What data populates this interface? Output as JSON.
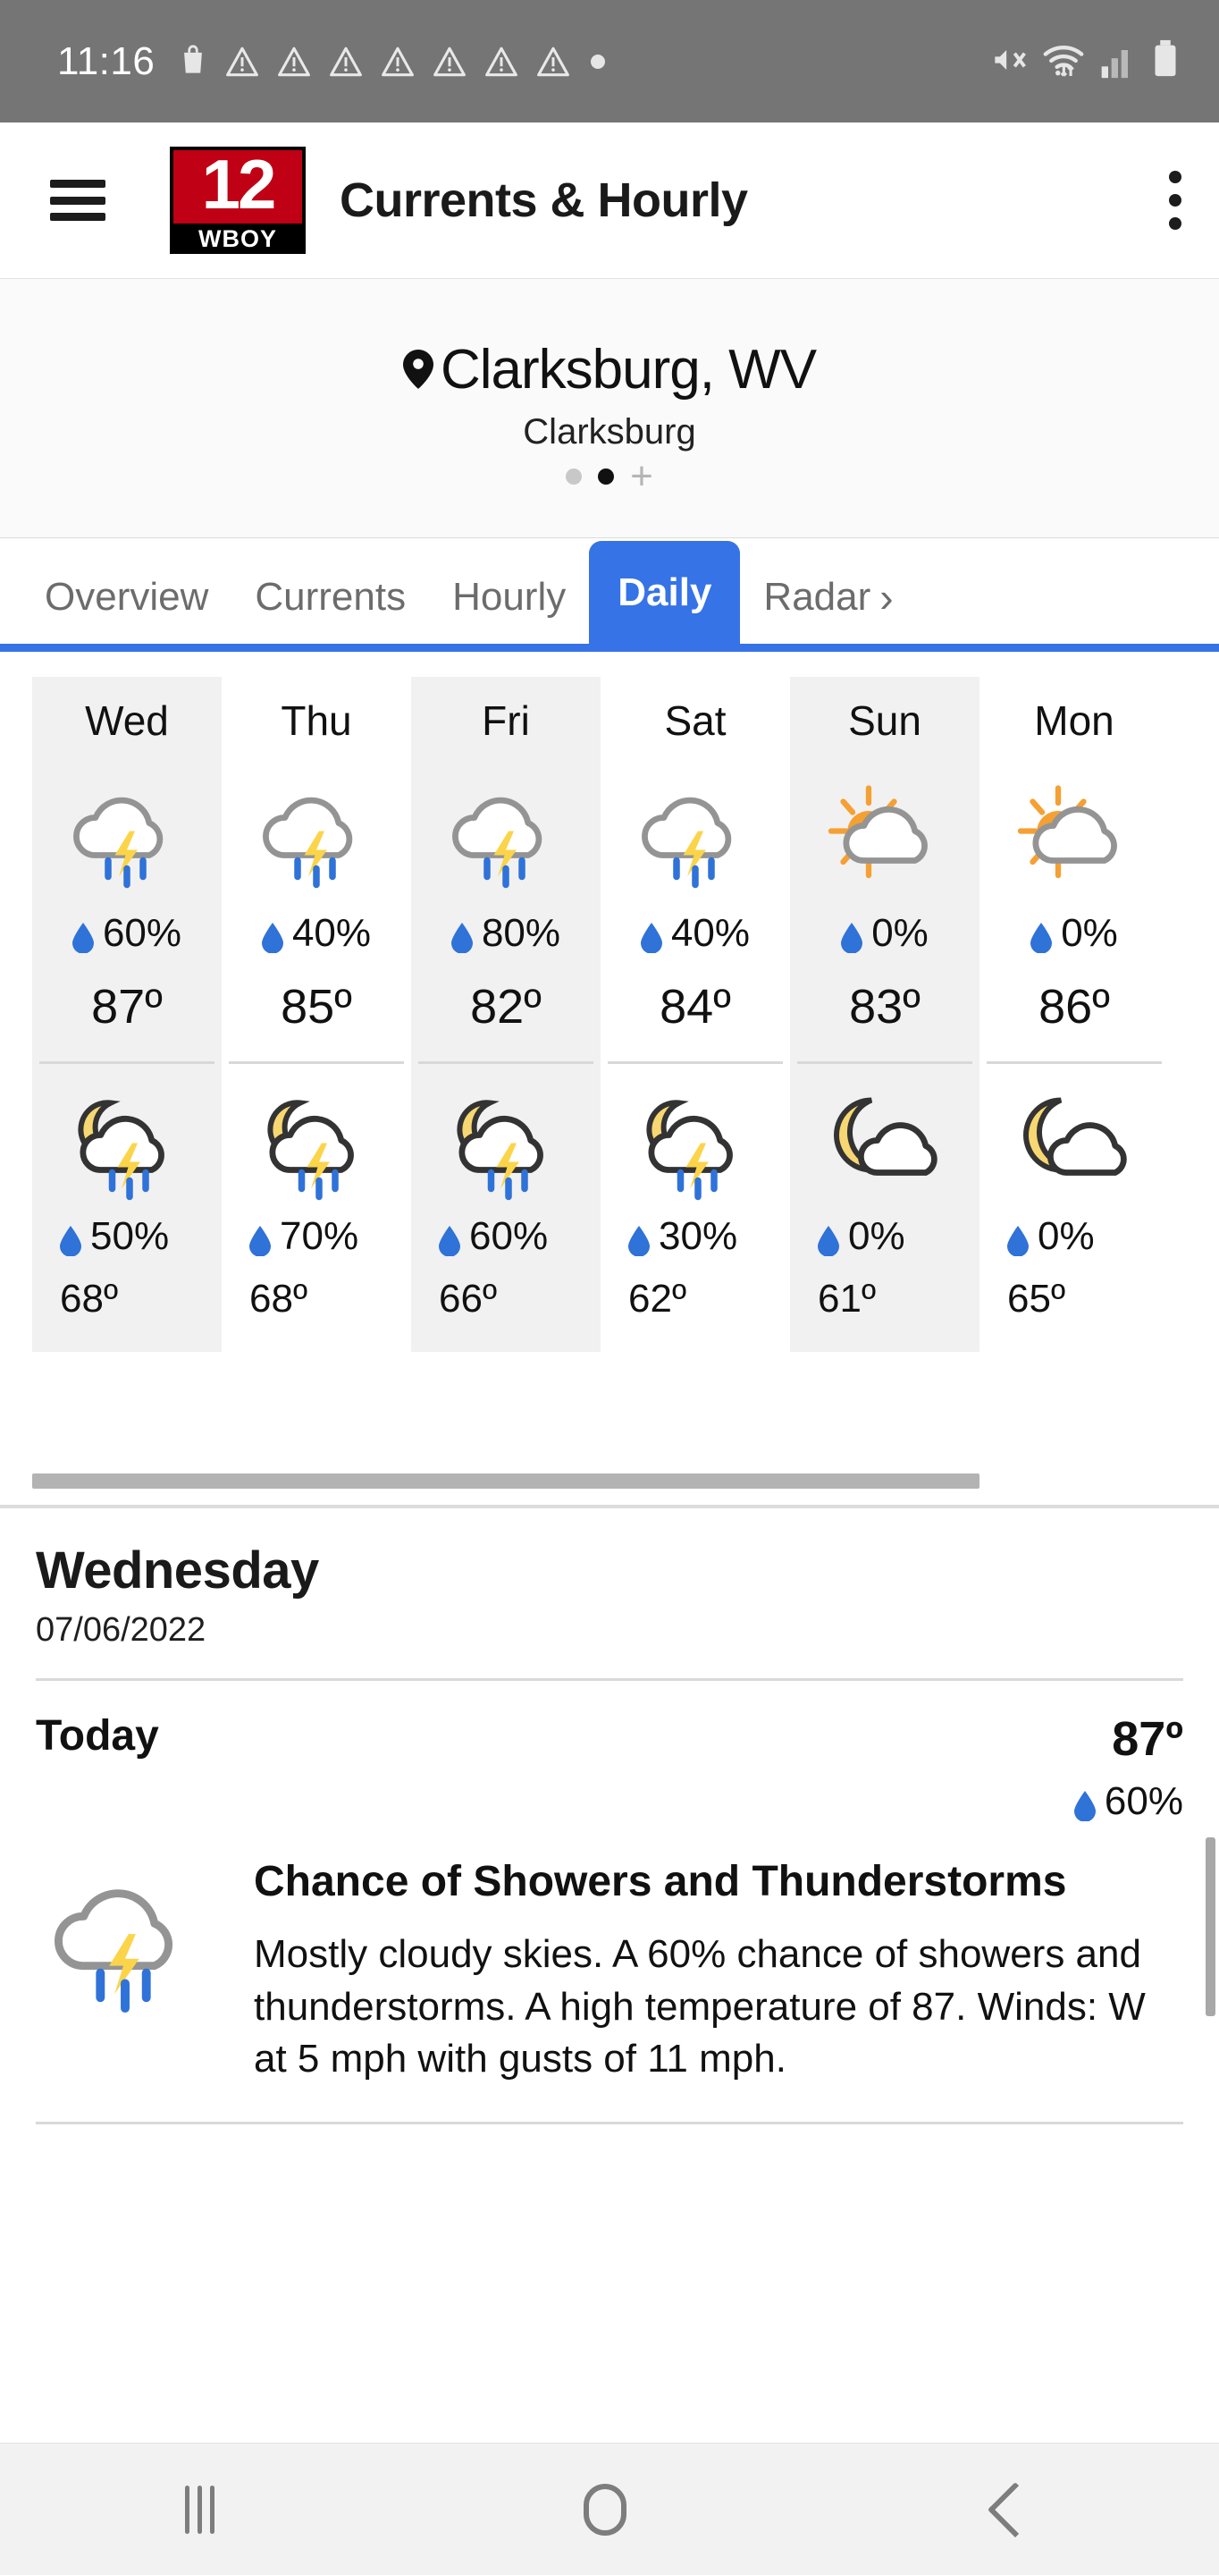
{
  "statusbar": {
    "clock": "11:16",
    "left_icons": [
      "shopping-bag-icon",
      "warning-triangle-icon",
      "warning-triangle-icon",
      "warning-triangle-icon",
      "warning-triangle-icon",
      "warning-triangle-icon",
      "warning-triangle-icon",
      "warning-triangle-icon",
      "more-dot-icon"
    ],
    "right_icons": [
      "mute-icon",
      "wifi-icon",
      "cellular-signal-icon",
      "battery-icon"
    ]
  },
  "appbar": {
    "menu_icon": "hamburger-icon",
    "logo_number": "12",
    "logo_callsign": "WBOY",
    "title": "Currents & Hourly",
    "overflow_icon": "kebab-menu-icon"
  },
  "location": {
    "pin_icon": "location-pin-icon",
    "name": "Clarksburg, WV",
    "sub": "Clarksburg",
    "pager": {
      "count": 2,
      "active_index": 1,
      "add_label": "+"
    }
  },
  "tabs": {
    "items": [
      {
        "label": "Overview",
        "active": false
      },
      {
        "label": "Currents",
        "active": false
      },
      {
        "label": "Hourly",
        "active": false
      },
      {
        "label": "Daily",
        "active": true
      },
      {
        "label": "Radar",
        "active": false
      }
    ],
    "overflow_icon": "chevron-right-icon",
    "accent_color": "#3573e6"
  },
  "daily": [
    {
      "day": "Wed",
      "day_icon": "thunderstorm-day-icon",
      "day_pop": "60%",
      "high": "87º",
      "night_icon": "thunderstorm-night-icon",
      "night_pop": "50%",
      "low": "68º"
    },
    {
      "day": "Thu",
      "day_icon": "thunderstorm-day-icon",
      "day_pop": "40%",
      "high": "85º",
      "night_icon": "thunderstorm-night-icon",
      "night_pop": "70%",
      "low": "68º"
    },
    {
      "day": "Fri",
      "day_icon": "thunderstorm-day-icon",
      "day_pop": "80%",
      "high": "82º",
      "night_icon": "thunderstorm-night-icon",
      "night_pop": "60%",
      "low": "66º"
    },
    {
      "day": "Sat",
      "day_icon": "thunderstorm-day-icon",
      "day_pop": "40%",
      "high": "84º",
      "night_icon": "thunderstorm-night-icon",
      "night_pop": "30%",
      "low": "62º"
    },
    {
      "day": "Sun",
      "day_icon": "partly-sunny-icon",
      "day_pop": "0%",
      "high": "83º",
      "night_icon": "partly-cloudy-night-icon",
      "night_pop": "0%",
      "low": "61º"
    },
    {
      "day": "Mon",
      "day_icon": "partly-sunny-icon",
      "day_pop": "0%",
      "high": "86º",
      "night_icon": "partly-cloudy-night-icon",
      "night_pop": "0%",
      "low": "65º"
    }
  ],
  "detail": {
    "weekday": "Wednesday",
    "date": "07/06/2022",
    "period_label": "Today",
    "period_temp": "87º",
    "period_pop": "60%",
    "condition_icon": "thunderstorm-day-icon",
    "condition_title": "Chance of Showers and Thunderstorms",
    "description": "Mostly cloudy skies.  A 60% chance of showers and thunderstorms.  A high temperature of 87.  Winds: W at 5 mph with gusts of 11 mph."
  },
  "navbar": {
    "recents_icon": "recents-icon",
    "home_icon": "home-icon",
    "back_icon": "back-icon"
  },
  "colors": {
    "accent": "#3573e6",
    "rain_drop": "#2f72d8",
    "lightning": "#fbd44a",
    "sun": "#f5a033",
    "moon": "#f7d772",
    "cloud_outline_day": "#949494",
    "cloud_outline_night": "#333333",
    "status_bar": "#757575",
    "card_alt": "#f1f1f1"
  }
}
